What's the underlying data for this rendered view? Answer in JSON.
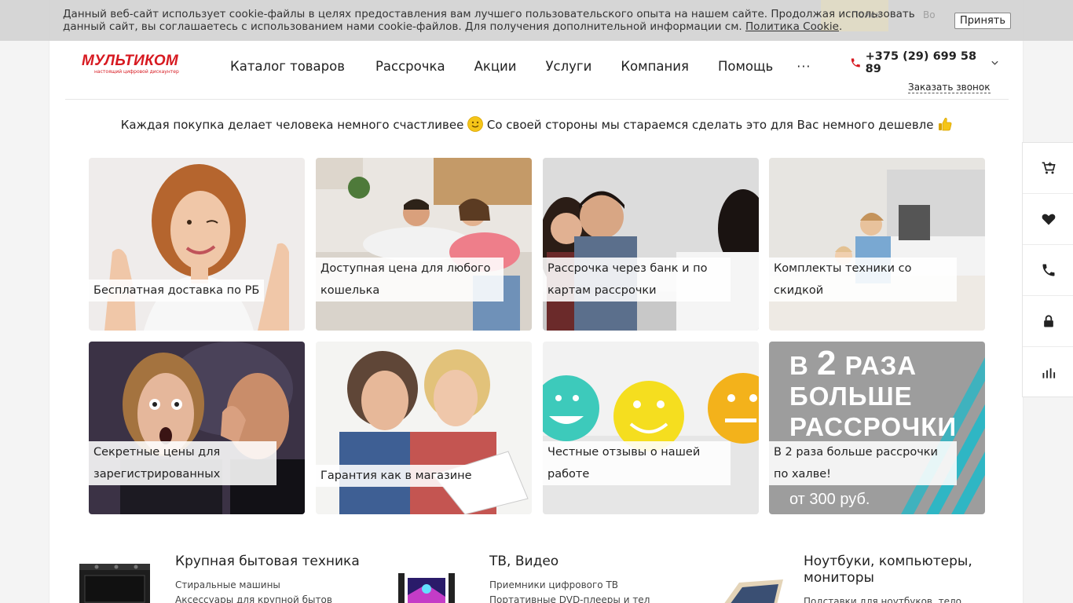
{
  "cookie": {
    "text": "Данный веб-сайт использует cookie-файлы в целях предоставления вам лучшего пользовательского опыта на нашем сайте. Продолжая использовать данный сайт, вы соглашаетесь с использованием нами cookie-файлов. Для получения дополнительной информации см.",
    "link": "Политика Cookie",
    "link_suffix": ".",
    "accept": "Принять",
    "behind_search": "Поиск",
    "behind_login": "Во"
  },
  "logo": {
    "name": "МУЛЬТИКОМ",
    "tagline": "настоящий цифровой дискаунтер"
  },
  "nav": [
    "Каталог товаров",
    "Рассрочка",
    "Акции",
    "Услуги",
    "Компания",
    "Помощь"
  ],
  "nav_more": "···",
  "contact": {
    "phone": "+375 (29) 699 58 89",
    "callback": "Заказать звонок"
  },
  "slogan": {
    "part1": "Каждая покупка делает человека немного счастливее",
    "part2": "Со своей стороны мы стараемся сделать это для Вас немного дешевле"
  },
  "tiles": [
    {
      "caption": "Бесплатная доставка по РБ"
    },
    {
      "caption": "Доступная цена для любого кошелька"
    },
    {
      "caption": "Рассрочка через банк и по картам рассрочки"
    },
    {
      "caption": "Комплекты техники со скидкой"
    },
    {
      "caption": "Секретные цены для зарегистрированных"
    },
    {
      "caption": "Гарантия как в магазине"
    },
    {
      "caption": "Честные отзывы о нашей работе"
    },
    {
      "caption": "В 2 раза больше рассрочки по халве!"
    }
  ],
  "promo": {
    "line1a": "В ",
    "line1b": "2",
    "line1c": " РАЗА",
    "line2": "БОЛЬШЕ",
    "line3": "РАССРОЧКИ",
    "sub": "от 300 руб."
  },
  "categories": [
    {
      "title": "Крупная бытовая техника",
      "links": [
        "Стиральные машины",
        "Аксессуары для крупной бытов"
      ]
    },
    {
      "title": "ТВ, Видео",
      "links": [
        "Приемники цифрового ТВ",
        "Портативные DVD-плееры и тел"
      ]
    },
    {
      "title": "Ноутбуки, компьютеры, мониторы",
      "links": [
        "Подставки для ноутбуков, тело"
      ]
    }
  ],
  "sidebar": [
    "cart-icon",
    "heart-icon",
    "phone-icon",
    "lock-icon",
    "compare-icon"
  ],
  "colors": {
    "brand": "#d71920",
    "promo_bg": "#9d9d9d",
    "promo_stripe": "#2fb6c4"
  }
}
